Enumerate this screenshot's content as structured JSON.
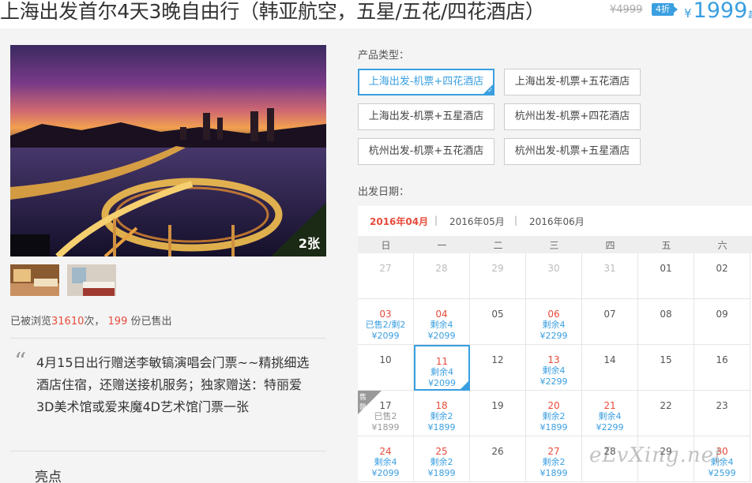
{
  "header": {
    "title": "上海出发首尔4天3晚自由行（韩亚航空，五星/五花/四花酒店）",
    "old_price": "¥4999",
    "discount": "4折",
    "price_symbol": "¥",
    "price": "1999",
    "price_suffix": "起"
  },
  "gallery": {
    "photo_count": "2张"
  },
  "stats": {
    "prefix": "已被浏览",
    "views": "31610",
    "mid": "次，",
    "sold": "199",
    "suffix": "份已售出"
  },
  "promo": {
    "text": "4月15日出行赠送李敏镐演唱会门票~~精挑细选酒店住宿，还赠送接机服务；独家赠送：特丽爱3D美术馆或爱来魔4D艺术馆门票一张"
  },
  "highlights": {
    "title": "亮点"
  },
  "product_type": {
    "label": "产品类型：",
    "options": [
      {
        "label": "上海出发-机票+四花酒店",
        "selected": true
      },
      {
        "label": "上海出发-机票+五花酒店",
        "selected": false
      },
      {
        "label": "上海出发-机票+五星酒店",
        "selected": false
      },
      {
        "label": "杭州出发-机票+四花酒店",
        "selected": false
      },
      {
        "label": "杭州出发-机票+五花酒店",
        "selected": false
      },
      {
        "label": "杭州出发-机票+五星酒店",
        "selected": false
      }
    ]
  },
  "departure": {
    "label": "出发日期：",
    "months": [
      "2016年04月",
      "2016年05月",
      "2016年06月"
    ],
    "month_sep": "|",
    "active_month": 0,
    "weekdays": [
      "日",
      "一",
      "二",
      "三",
      "四",
      "五",
      "六"
    ],
    "weeks": [
      [
        {
          "day": "27",
          "state": "past"
        },
        {
          "day": "28",
          "state": "past"
        },
        {
          "day": "29",
          "state": "past"
        },
        {
          "day": "30",
          "state": "past"
        },
        {
          "day": "31",
          "state": "past"
        },
        {
          "day": "01",
          "state": "normal"
        },
        {
          "day": "02",
          "state": "normal"
        }
      ],
      [
        {
          "day": "03",
          "state": "avail",
          "stock": "已售2/剩2",
          "price": "¥2099"
        },
        {
          "day": "04",
          "state": "avail",
          "stock": "剩余4",
          "price": "¥2099"
        },
        {
          "day": "05",
          "state": "normal"
        },
        {
          "day": "06",
          "state": "avail",
          "stock": "剩余4",
          "price": "¥2299"
        },
        {
          "day": "07",
          "state": "normal"
        },
        {
          "day": "08",
          "state": "normal"
        },
        {
          "day": "09",
          "state": "normal"
        }
      ],
      [
        {
          "day": "10",
          "state": "normal"
        },
        {
          "day": "11",
          "state": "avail",
          "stock": "剩余4",
          "price": "¥2099",
          "selected": true
        },
        {
          "day": "12",
          "state": "normal"
        },
        {
          "day": "13",
          "state": "avail",
          "stock": "剩余4",
          "price": "¥2299"
        },
        {
          "day": "14",
          "state": "normal"
        },
        {
          "day": "15",
          "state": "normal"
        },
        {
          "day": "16",
          "state": "normal"
        }
      ],
      [
        {
          "day": "17",
          "state": "soldout",
          "stock": "已售2",
          "price": "¥1899",
          "tag": "售罄"
        },
        {
          "day": "18",
          "state": "avail",
          "stock": "剩余2",
          "price": "¥1899"
        },
        {
          "day": "19",
          "state": "normal"
        },
        {
          "day": "20",
          "state": "avail",
          "stock": "剩余2",
          "price": "¥1899"
        },
        {
          "day": "21",
          "state": "avail",
          "stock": "剩余4",
          "price": "¥2299"
        },
        {
          "day": "22",
          "state": "normal"
        },
        {
          "day": "23",
          "state": "normal"
        }
      ],
      [
        {
          "day": "24",
          "state": "avail",
          "stock": "剩余4",
          "price": "¥2099"
        },
        {
          "day": "25",
          "state": "avail",
          "stock": "剩余2",
          "price": "¥1899"
        },
        {
          "day": "26",
          "state": "normal"
        },
        {
          "day": "27",
          "state": "avail",
          "stock": "剩余2",
          "price": "¥1899"
        },
        {
          "day": "28",
          "state": "normal"
        },
        {
          "day": "29",
          "state": "normal"
        },
        {
          "day": "30",
          "state": "avail",
          "stock": "剩余4",
          "price": "¥2599"
        }
      ]
    ]
  },
  "watermark": "eLvXing.net",
  "colors": {
    "accent": "#3a9fe0",
    "red": "#e74c3c"
  }
}
